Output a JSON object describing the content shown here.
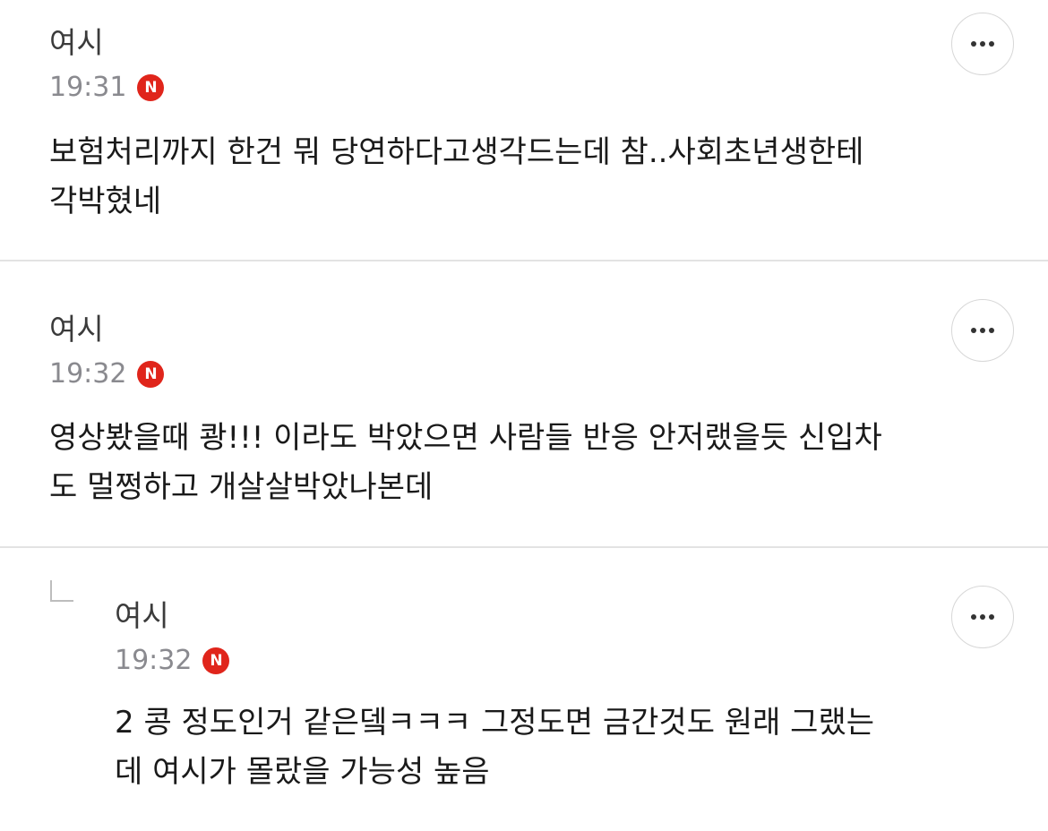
{
  "comments": [
    {
      "author": "여시",
      "time": "19:31",
      "badge": "N",
      "lines": [
        "보험처리까지 한건 뭐 당연하다고생각드는데 참..사회초년생한테",
        "각박혔네"
      ],
      "is_reply": false
    },
    {
      "author": "여시",
      "time": "19:32",
      "badge": "N",
      "lines": [
        "영상봤을때 쾅!!! 이라도 박았으면 사람들 반응 안저랬을듯 신입차",
        "도 멀쩡하고 개살살박았나본데"
      ],
      "is_reply": false
    },
    {
      "author": "여시",
      "time": "19:32",
      "badge": "N",
      "lines": [
        "2 콩 정도인거 같은뎈ㅋㅋㅋ 그정도면 금간것도 원래 그랬는",
        "데 여시가 몰랐을 가능성 높음"
      ],
      "is_reply": true
    }
  ],
  "icons": {
    "more": "more-horizontal-icon",
    "reply": "reply-arrow-icon",
    "new_badge": "new-badge-icon"
  },
  "colors": {
    "badge": "#e0251b",
    "time": "#8a8a8f",
    "divider": "#e3e3e3"
  }
}
